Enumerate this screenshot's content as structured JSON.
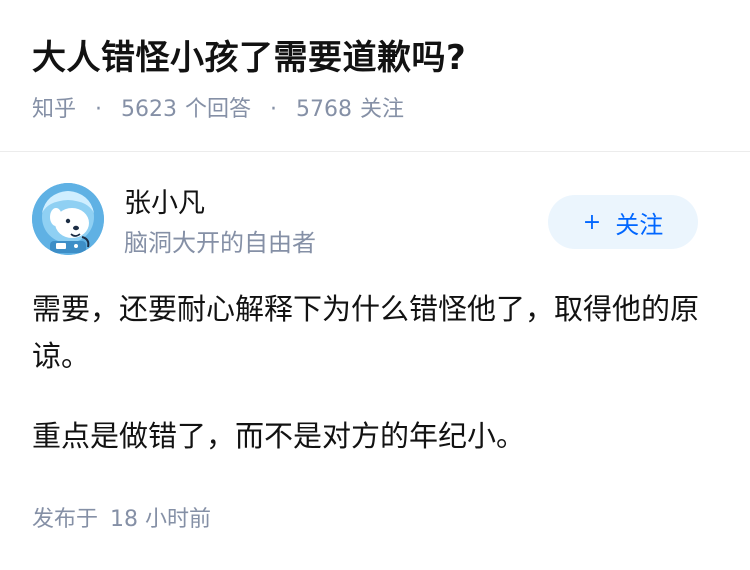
{
  "question": {
    "title": "大人错怪小孩了需要道歉吗?",
    "source": "知乎",
    "answer_count": "5623",
    "answer_count_label": "个回答",
    "follower_count": "5768",
    "follower_count_label": "关注",
    "separator": "·"
  },
  "author": {
    "name": "张小凡",
    "bio": "脑洞大开的自由者",
    "avatar_icon": "dog-astronaut-avatar",
    "follow_icon": "plus-icon",
    "follow_label": "关注",
    "follow_plus": "+"
  },
  "answer": {
    "paragraphs": [
      "需要，还要耐心解释下为什么错怪他了，取得他的原谅。",
      "重点是做错了，而不是对方的年纪小。"
    ],
    "publish_label": "发布于",
    "publish_time": "18 小时前"
  },
  "colors": {
    "accent": "#0066ff",
    "follow_bg": "#ebf5fd",
    "meta_gray": "#8590a6",
    "avatar_bg": "#5fb1e4"
  }
}
